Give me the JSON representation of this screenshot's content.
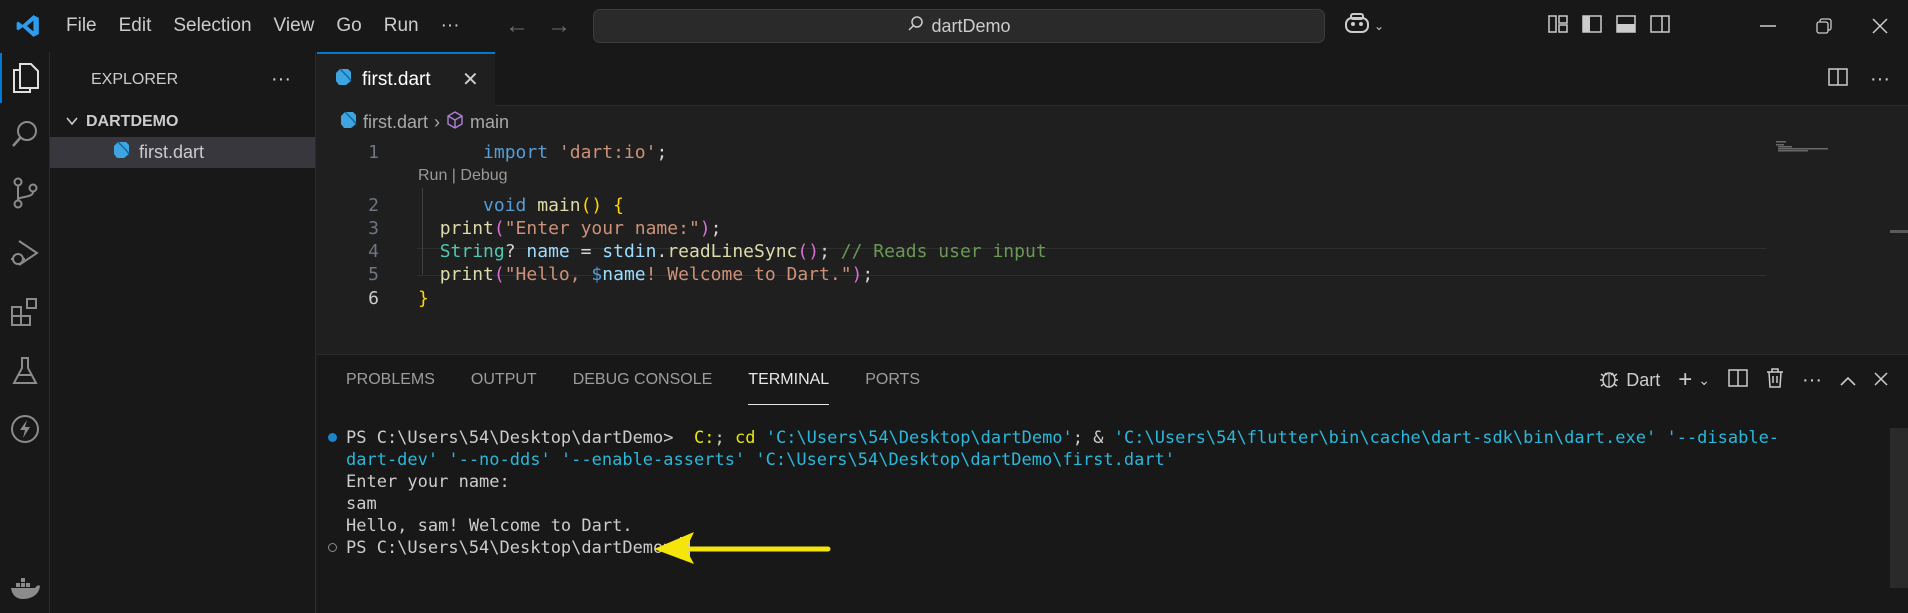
{
  "titlebar": {
    "menu": [
      "File",
      "Edit",
      "Selection",
      "View",
      "Go",
      "Run",
      "···"
    ],
    "search_text": "dartDemo",
    "icons": [
      "vscode-logo-icon",
      "arrow-left-icon",
      "arrow-right-icon",
      "search-icon",
      "copilot-icon",
      "customize-layout-icon",
      "toggle-sidebar-icon",
      "toggle-panel-icon",
      "toggle-secondary-sidebar-icon",
      "minimize-icon",
      "restore-icon",
      "close-icon"
    ]
  },
  "activitybar": {
    "items": [
      "explorer-icon",
      "search-icon",
      "source-control-icon",
      "run-debug-icon",
      "extensions-icon",
      "testing-icon",
      "lightning-icon",
      "docker-icon"
    ]
  },
  "sidebar": {
    "title": "EXPLORER",
    "more": "···",
    "folder": "DARTDEMO",
    "file": "first.dart"
  },
  "editor": {
    "tab_label": "first.dart",
    "breadcrumb": [
      "first.dart",
      "main"
    ],
    "codelens": "Run | Debug",
    "line_numbers": [
      "1",
      "2",
      "3",
      "4",
      "5",
      "6"
    ],
    "code": {
      "l1_kw": "import",
      "l1_str": "'dart:io'",
      "l1_end": ";",
      "l2_kw": "void",
      "l2_fn": "main",
      "l2_paren": "()",
      "l2_brace": "{",
      "l3_fn": "print",
      "l3_str": "\"Enter your name:\"",
      "l4_type": "String",
      "l4_q": "?",
      "l4_var": "name",
      "l4_eq": "=",
      "l4_obj": "stdin",
      "l4_method": "readLineSync",
      "l4_comment": "// Reads user input",
      "l5_fn": "print",
      "l5_str_a": "\"Hello, ",
      "l5_interp": "$",
      "l5_var": "name",
      "l5_str_b": "! Welcome to Dart.\"",
      "l6_brace": "}"
    }
  },
  "panel": {
    "tabs": [
      "PROBLEMS",
      "OUTPUT",
      "DEBUG CONSOLE",
      "TERMINAL",
      "PORTS"
    ],
    "active_tab": "TERMINAL",
    "terminal_name": "Dart",
    "terminal": {
      "prompt1": "PS C:\\Users\\54\\Desktop\\dartDemo> ",
      "cmd_c": "C:",
      "cmd_sep": ";",
      "cmd_cd": "cd",
      "cmd_path1": "'C:\\Users\\54\\Desktop\\dartDemo'",
      "cmd_amp": "; &",
      "cmd_exe": "'C:\\Users\\54\\flutter\\bin\\cache\\dart-sdk\\bin\\dart.exe'",
      "cmd_flag_a": "'--disable-",
      "cmd_line2": "dart-dev' '--no-dds' '--enable-asserts' 'C:\\Users\\54\\Desktop\\dartDemo\\first.dart'",
      "out1": "Enter your name:",
      "out2": "sam",
      "out3": "Hello, sam! Welcome to Dart.",
      "prompt2": "PS C:\\Users\\54\\Desktop\\dartDemo>"
    }
  },
  "colors": {
    "accent": "#0078d4",
    "annotation_arrow": "#f5e50a"
  }
}
